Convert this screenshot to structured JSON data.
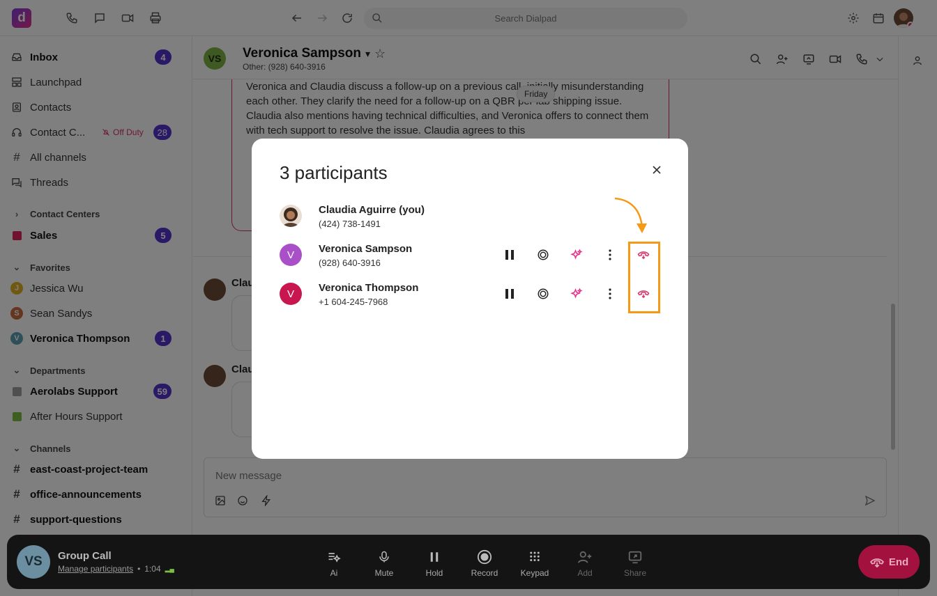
{
  "app": {
    "logo_letter": "d"
  },
  "topbar": {
    "search_placeholder": "Search Dialpad"
  },
  "sidebar": {
    "items": [
      {
        "label": "Inbox",
        "badge": "4"
      },
      {
        "label": "Launchpad"
      },
      {
        "label": "Contacts"
      },
      {
        "label": "Contact C...",
        "status": "Off Duty",
        "badge": "28"
      },
      {
        "label": "All channels"
      },
      {
        "label": "Threads"
      }
    ],
    "contact_centers": {
      "title": "Contact Centers",
      "items": [
        {
          "label": "Sales",
          "badge": "5"
        }
      ]
    },
    "favorites": {
      "title": "Favorites",
      "items": [
        {
          "initial": "J",
          "label": "Jessica Wu"
        },
        {
          "initial": "S",
          "label": "Sean Sandys"
        },
        {
          "initial": "V",
          "label": "Veronica Thompson",
          "badge": "1"
        }
      ]
    },
    "departments": {
      "title": "Departments",
      "items": [
        {
          "label": "Aerolabs Support",
          "badge": "59"
        },
        {
          "label": "After Hours Support"
        }
      ]
    },
    "channels": {
      "title": "Channels",
      "items": [
        {
          "label": "east-coast-project-team"
        },
        {
          "label": "office-announcements"
        },
        {
          "label": "support-questions"
        }
      ]
    }
  },
  "conversation": {
    "initials": "VS",
    "name": "Veronica Sampson",
    "subtitle": "Other: (928) 640-3916",
    "summary_text": "Veronica and Claudia discuss a follow-up on a previous call, initially misunderstanding each other. They clarify the need for a follow-up on a QBR per lab shipping issue. Claudia also mentions having technical difficulties, and Veronica offers to connect them with tech support to resolve the issue. Claudia agrees to this",
    "date_pill": "Friday",
    "sender_partial_1": "Clau",
    "sender_partial_2": "Clau",
    "compose_placeholder": "New message"
  },
  "modal": {
    "title": "3 participants",
    "participants": [
      {
        "name": "Claudia Aguirre (you)",
        "number": "(424) 738-1491",
        "avatar": "photo"
      },
      {
        "name": "Veronica Sampson",
        "number": "(928) 640-3916",
        "initial": "V",
        "color": "#a950c8"
      },
      {
        "name": "Veronica Thompson",
        "number": "+1 604-245-7968",
        "initial": "V",
        "color": "#c8174f"
      }
    ]
  },
  "callbar": {
    "initials": "VS",
    "title": "Group Call",
    "manage_label": "Manage participants",
    "duration": "1:04",
    "controls": [
      {
        "label": "Ai",
        "icon": "ai-icon"
      },
      {
        "label": "Mute",
        "icon": "microphone-icon"
      },
      {
        "label": "Hold",
        "icon": "pause-icon"
      },
      {
        "label": "Record",
        "icon": "record-icon"
      },
      {
        "label": "Keypad",
        "icon": "keypad-icon"
      },
      {
        "label": "Add",
        "icon": "add-person-icon"
      },
      {
        "label": "Share",
        "icon": "share-screen-icon"
      }
    ],
    "end_label": "End"
  },
  "colors": {
    "accent": "#5533cc",
    "end_call": "#a3123f",
    "highlight": "#f49a16",
    "ai_pink": "#e8318c"
  }
}
